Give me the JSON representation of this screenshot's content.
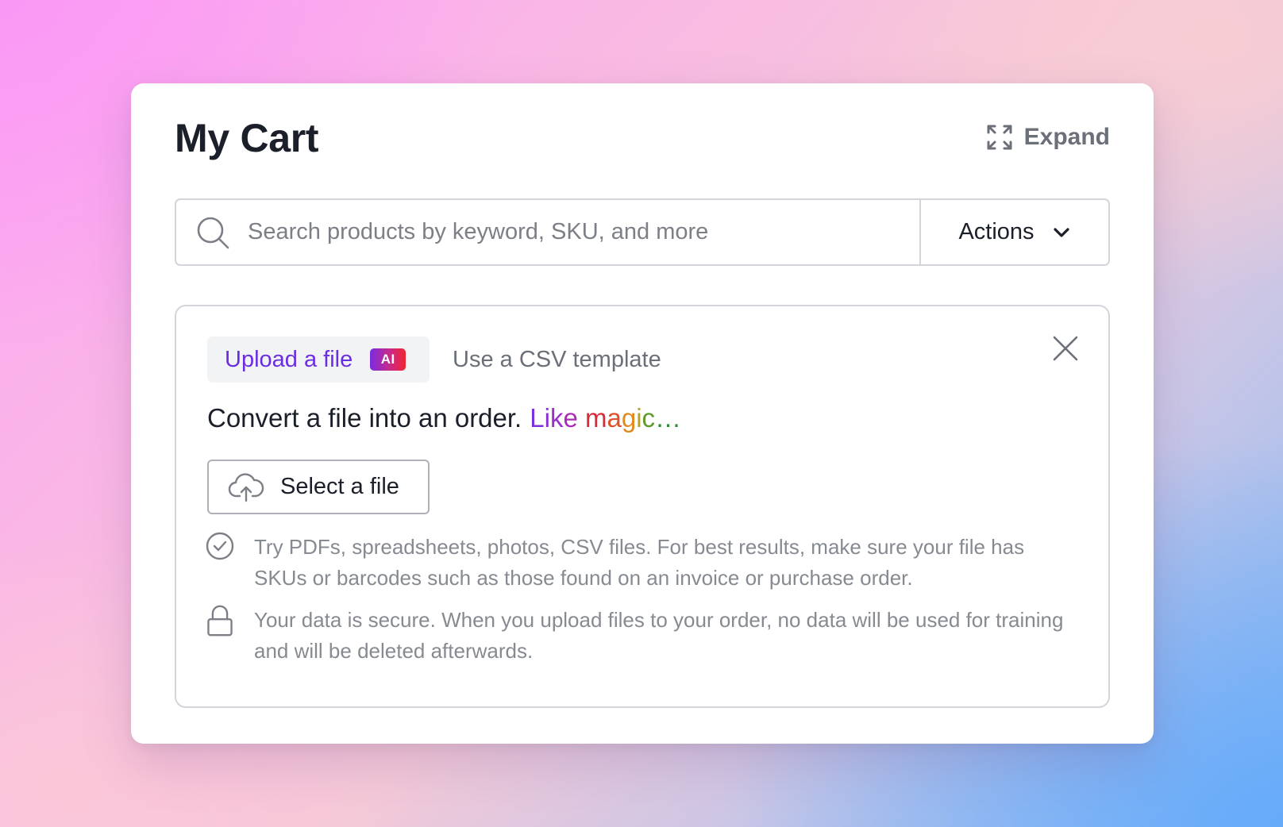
{
  "card": {
    "title": "My Cart",
    "expand_label": "Expand"
  },
  "search": {
    "placeholder": "Search products by keyword, SKU, and more",
    "value": ""
  },
  "actions": {
    "label": "Actions"
  },
  "upload_panel": {
    "tabs": [
      {
        "label": "Upload a file",
        "badge": "AI",
        "active": true
      },
      {
        "label": "Use a CSV template",
        "active": false
      }
    ],
    "headline": "Convert a file into an order.",
    "headline_magic": [
      "L",
      "i",
      "k",
      "e",
      " ",
      "m",
      "a",
      "g",
      "i",
      "c",
      "…"
    ],
    "magic_colors": [
      "#7c2fe0",
      "#8a2ed8",
      "#9a2ecf",
      "#ac2cb6",
      "#c4285e",
      "#d92a3a",
      "#e0502a",
      "#e08a20",
      "#b8a020",
      "#5f9a2a",
      "#2f8a3a"
    ],
    "select_button_label": "Select a file",
    "info": [
      {
        "icon": "check-circle-icon",
        "text": "Try PDFs, spreadsheets, photos, CSV files. For best results, make sure your file has SKUs or barcodes such as those found on an invoice or purchase order."
      },
      {
        "icon": "lock-icon",
        "text": "Your data is secure. When you upload files to your order, no data will be used for training and will be deleted afterwards."
      }
    ]
  },
  "colors": {
    "accent_purple": "#6a2ee0",
    "text_dark": "#1b1f2a",
    "text_muted": "#868a91",
    "border": "#d3d5da"
  }
}
